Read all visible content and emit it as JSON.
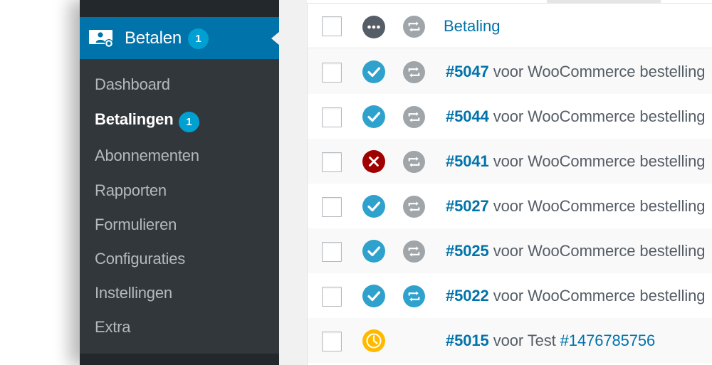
{
  "sidebar": {
    "menu_label": "Betalen",
    "menu_badge": "1",
    "submenu": [
      {
        "label": "Dashboard"
      },
      {
        "label": "Betalingen",
        "badge": "1"
      },
      {
        "label": "Abonnementen"
      },
      {
        "label": "Rapporten"
      },
      {
        "label": "Formulieren"
      },
      {
        "label": "Configuraties"
      },
      {
        "label": "Instellingen"
      },
      {
        "label": "Extra"
      }
    ]
  },
  "table": {
    "header": {
      "column_title": "Betaling",
      "status_icon": "more-dots-icon",
      "recurring_icon": "recurring-icon"
    },
    "rows": [
      {
        "number": "#5047",
        "text": " voor WooCommerce bestelling",
        "status": "success",
        "recurring_active": false
      },
      {
        "number": "#5044",
        "text": " voor WooCommerce bestelling",
        "status": "success",
        "recurring_active": false
      },
      {
        "number": "#5041",
        "text": " voor WooCommerce bestelling",
        "status": "failed",
        "recurring_active": false
      },
      {
        "number": "#5027",
        "text": " voor WooCommerce bestelling",
        "status": "success",
        "recurring_active": false
      },
      {
        "number": "#5025",
        "text": " voor WooCommerce bestelling",
        "status": "success",
        "recurring_active": false
      },
      {
        "number": "#5022",
        "text": " voor WooCommerce bestelling",
        "status": "success",
        "recurring_active": true
      },
      {
        "number": "#5015",
        "text": " voor Test ",
        "link": "#1476785756",
        "status": "pending",
        "recurring_active": null
      }
    ]
  },
  "colors": {
    "sidebar_bg": "#32373c",
    "active_menu_bg": "#0073aa",
    "badge": "#00a0d2",
    "link": "#0073aa",
    "success": "#2ea2cc",
    "failed": "#a00000",
    "pending": "#ffba00",
    "recurring_inactive": "#a0a5aa",
    "recurring_active": "#2ea2cc"
  }
}
